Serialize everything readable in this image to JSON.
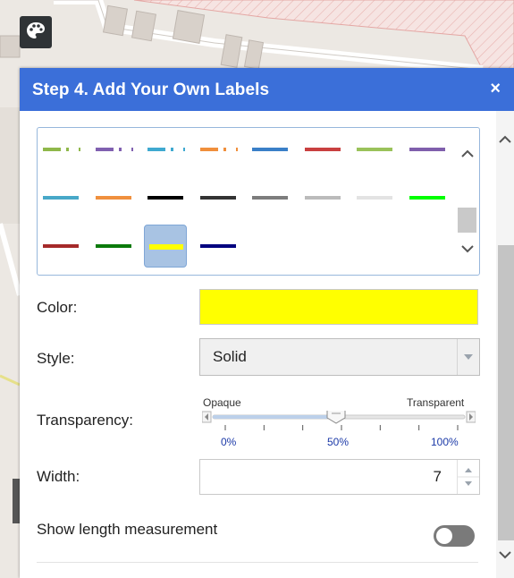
{
  "dialog": {
    "title": "Step 4. Add Your Own Labels",
    "close_symbol": "×"
  },
  "icons": {
    "palette_button": "palette-icon",
    "close": "close-icon",
    "scroll_up": "chevron-up-icon",
    "scroll_down": "chevron-down-icon"
  },
  "swatches": [
    {
      "color": "#8fb84a",
      "style": "dash-dot"
    },
    {
      "color": "#8060b0",
      "style": "dash-dot"
    },
    {
      "color": "#3fa9d0",
      "style": "dash-dot"
    },
    {
      "color": "#f08f3c",
      "style": "dash-dot"
    },
    {
      "color": "#3a7fc8",
      "style": "solid"
    },
    {
      "color": "#c94040",
      "style": "solid"
    },
    {
      "color": "#9ac25a",
      "style": "solid"
    },
    {
      "color": "#7f5fac",
      "style": "solid"
    },
    {
      "color": "#48a8c8",
      "style": "solid"
    },
    {
      "color": "#f0903e",
      "style": "solid"
    },
    {
      "color": "#000000",
      "style": "solid"
    },
    {
      "color": "#333333",
      "style": "solid"
    },
    {
      "color": "#7d7d7d",
      "style": "solid"
    },
    {
      "color": "#bbbbbb",
      "style": "solid"
    },
    {
      "color": "#e3e3e3",
      "style": "solid"
    },
    {
      "color": "#00ff00",
      "style": "solid"
    },
    {
      "color": "#a52a2a",
      "style": "solid"
    },
    {
      "color": "#0b7a0b",
      "style": "solid"
    },
    {
      "color": "#ffff00",
      "style": "solid",
      "selected": true
    },
    {
      "color": "#00007f",
      "style": "solid"
    }
  ],
  "form": {
    "color_label": "Color:",
    "color_value": "#ffff00",
    "style_label": "Style:",
    "style_value": "Solid",
    "transparency_label": "Transparency:",
    "transparency_min_label": "Opaque",
    "transparency_max_label": "Transparent",
    "transparency_ticks": [
      "0%",
      "50%",
      "100%"
    ],
    "transparency_value": 0.5,
    "width_label": "Width:",
    "width_value": "7",
    "length_label": "Show length measurement",
    "length_toggle_on": false
  },
  "colors": {
    "header": "#3b6fd9",
    "swatch_border": "#97b7dc",
    "selected_swatch": "#a8c3e3",
    "tick_text": "#1c3aa8"
  }
}
